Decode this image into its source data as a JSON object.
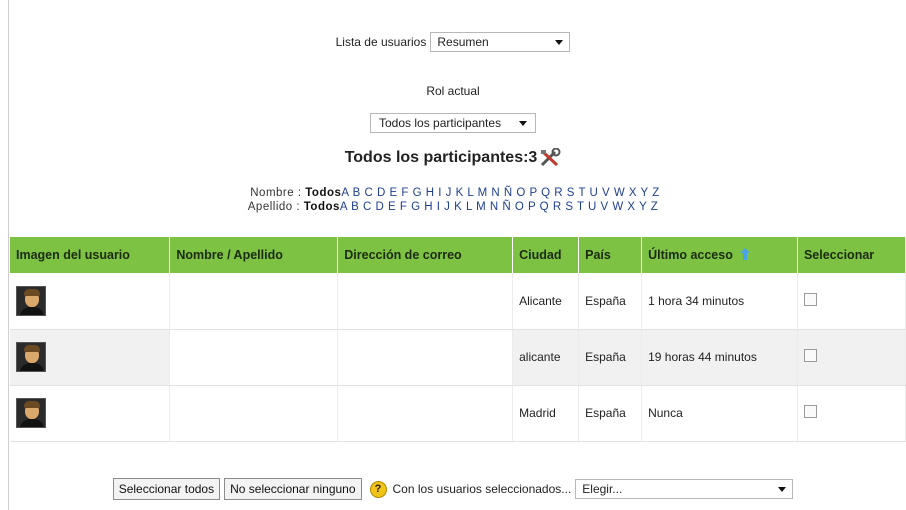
{
  "list": {
    "label": "Lista de usuarios",
    "selected": "Resumen"
  },
  "role": {
    "label": "Rol actual",
    "selected": "Todos los participantes"
  },
  "count": {
    "title": "Todos los participantes:3"
  },
  "filters": {
    "first": {
      "label": "Nombre :",
      "all": "Todos",
      "letters": "A B C D E F G H I J K L M N Ñ O P Q R S T U V W X Y Z"
    },
    "last": {
      "label": "Apellido :",
      "all": "Todos",
      "letters": "A B C D E F G H I J K L M N Ñ O P Q R S T U V W X Y Z"
    }
  },
  "table": {
    "headers": [
      "Imagen del usuario",
      "Nombre / Apellido",
      "Dirección de correo",
      "Ciudad",
      "País",
      "Último acceso",
      "Seleccionar"
    ],
    "rows": [
      {
        "name": "",
        "email": "",
        "city": "Alicante",
        "country": "España",
        "last_access": "1 hora 34 minutos"
      },
      {
        "name": "",
        "email": "",
        "city": "alicante",
        "country": "España",
        "last_access": "19 horas 44 minutos"
      },
      {
        "name": "",
        "email": "",
        "city": "Madrid",
        "country": "España",
        "last_access": "Nunca"
      }
    ]
  },
  "footer": {
    "select_all": "Seleccionar todos",
    "select_none": "No seleccionar ninguno",
    "help": "?",
    "with_selected": "Con los usuarios seleccionados...",
    "action_selected": "Elegir..."
  },
  "colors": {
    "header_bg": "#7dc242",
    "alt_row": "#f1f1f1",
    "help": "#f2c418"
  },
  "icons": {
    "tool": "tool-icon",
    "sort": "sort-up-icon",
    "help": "help-icon",
    "avatar": "avatar"
  }
}
